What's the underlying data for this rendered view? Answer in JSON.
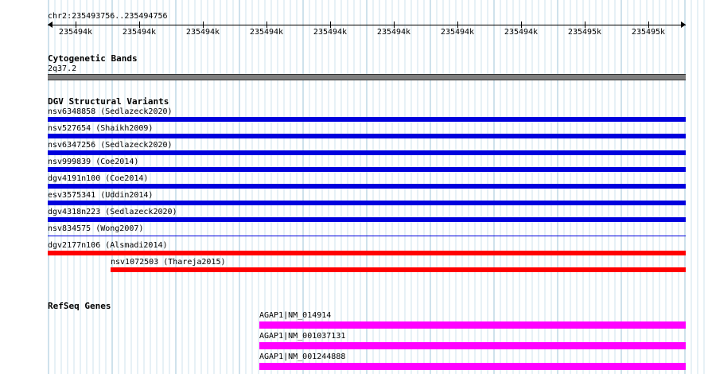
{
  "ruler": {
    "location": "chr2:235493756..235494756",
    "ticks": [
      "235494k",
      "235494k",
      "235494k",
      "235494k",
      "235494k",
      "235494k",
      "235494k",
      "235494k",
      "235495k",
      "235495k"
    ]
  },
  "cytoband": {
    "title": "Cytogenetic Bands",
    "band": "2q37.2",
    "color": "#7f7f7f"
  },
  "dgv": {
    "title": "DGV Structural Variants",
    "items": [
      {
        "label": "nsv6348858 (Sedlazeck2020)",
        "color": "#0000dd",
        "style": "thick"
      },
      {
        "label": "nsv527654 (Shaikh2009)",
        "color": "#0000dd",
        "style": "thick"
      },
      {
        "label": "nsv6347256 (Sedlazeck2020)",
        "color": "#0000dd",
        "style": "thick"
      },
      {
        "label": "nsv999839 (Coe2014)",
        "color": "#0000dd",
        "style": "thick"
      },
      {
        "label": "dgv4191n100 (Coe2014)",
        "color": "#0000dd",
        "style": "thick"
      },
      {
        "label": "esv3575341 (Uddin2014)",
        "color": "#0000dd",
        "style": "thick"
      },
      {
        "label": "dgv4318n223 (Sedlazeck2020)",
        "color": "#0000dd",
        "style": "thick"
      },
      {
        "label": "nsv834575 (Wong2007)",
        "color": "#0000dd",
        "style": "thin"
      },
      {
        "label": "dgv2177n106 (Alsmadi2014)",
        "color": "#ff0000",
        "style": "thick"
      },
      {
        "label": "nsv1072503 (Thareja2015)",
        "color": "#ff0000",
        "style": "thick"
      }
    ]
  },
  "refseq": {
    "title": "RefSeq Genes",
    "items": [
      {
        "label": "AGAP1|NM_014914",
        "color": "#ff00ff"
      },
      {
        "label": "AGAP1|NM_001037131",
        "color": "#ff00ff"
      },
      {
        "label": "AGAP1|NM_001244888",
        "color": "#ff00ff"
      }
    ]
  }
}
